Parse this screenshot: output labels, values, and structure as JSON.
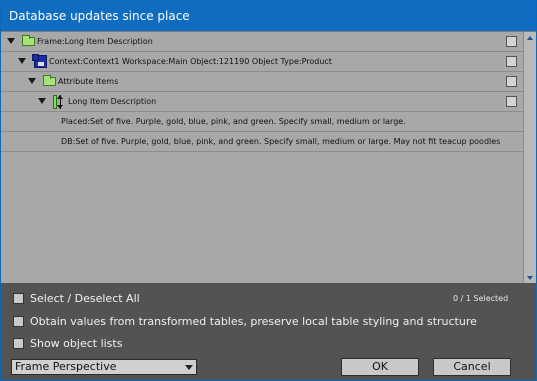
{
  "window": {
    "title": "Database updates since place"
  },
  "tree": {
    "frame_label": "Frame:Long Item Description",
    "context_label": "Context:Context1 Workspace:Main Object:121190 Object Type:Product",
    "attribute_items_label": "Attribute Items",
    "long_item_label": "Long Item Description",
    "placed_text": "Placed:Set of five. Purple, gold, blue, pink, and green. Specify small, medium or large.",
    "db_text": "DB:Set of five. Purple, gold, blue, pink, and green. Specify small, medium or large. May not fit teacup poodles"
  },
  "options": {
    "select_all_label": "Select / Deselect All",
    "selected_count": "0 / 1 Selected",
    "obtain_values_label": "Obtain values from transformed tables, preserve local table styling and structure",
    "show_lists_label": "Show object lists"
  },
  "footer": {
    "perspective_value": "Frame Perspective",
    "ok_label": "OK",
    "cancel_label": "Cancel"
  }
}
